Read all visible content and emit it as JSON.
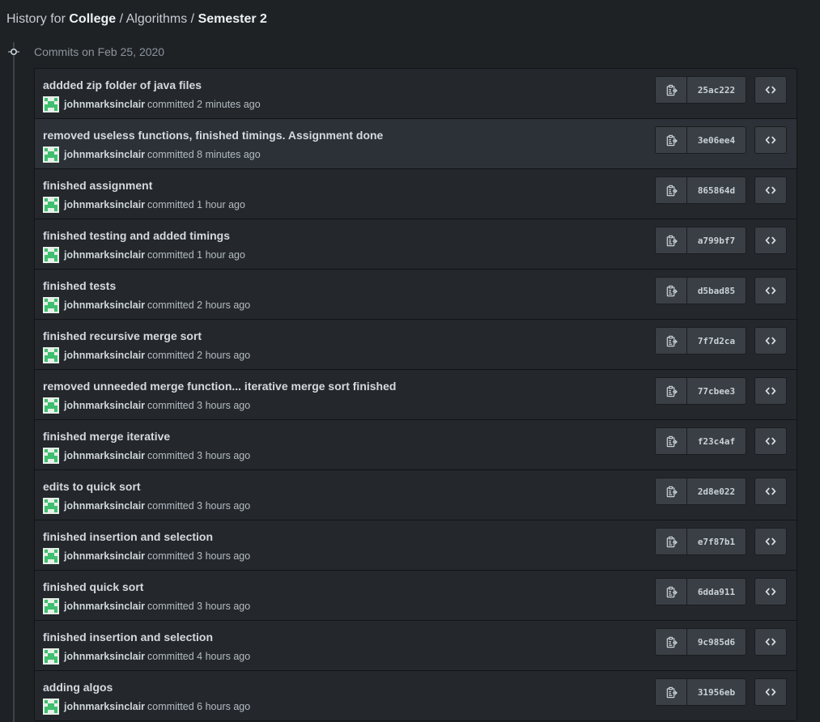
{
  "heading": {
    "prefix": "History for",
    "repo_owner": "College",
    "separator1": "/",
    "path_dir": "Algorithms",
    "separator2": "/",
    "path_current": "Semester 2"
  },
  "group": {
    "title": "Commits on Feb 25, 2020"
  },
  "colors": {
    "background": "#1f2225",
    "row": "#24282c",
    "row_highlight": "#2c3137",
    "button": "#3a3f45",
    "avatar_green": "#3fbf6f"
  },
  "icons": {
    "copy": "clipboard-icon",
    "browse": "code-icon",
    "timeline": "git-commit-icon"
  },
  "commits": [
    {
      "title": "addded zip folder of java files",
      "author": "johnmarksinclair",
      "time": "committed 2 minutes ago",
      "sha": "25ac222"
    },
    {
      "title": "removed useless functions, finished timings. Assignment done",
      "author": "johnmarksinclair",
      "time": "committed 8 minutes ago",
      "sha": "3e06ee4"
    },
    {
      "title": "finished assignment",
      "author": "johnmarksinclair",
      "time": "committed 1 hour ago",
      "sha": "865864d"
    },
    {
      "title": "finished testing and added timings",
      "author": "johnmarksinclair",
      "time": "committed 1 hour ago",
      "sha": "a799bf7"
    },
    {
      "title": "finished tests",
      "author": "johnmarksinclair",
      "time": "committed 2 hours ago",
      "sha": "d5bad85"
    },
    {
      "title": "finished recursive merge sort",
      "author": "johnmarksinclair",
      "time": "committed 2 hours ago",
      "sha": "7f7d2ca"
    },
    {
      "title": "removed unneeded merge function... iterative merge sort finished",
      "author": "johnmarksinclair",
      "time": "committed 3 hours ago",
      "sha": "77cbee3"
    },
    {
      "title": "finished merge iterative",
      "author": "johnmarksinclair",
      "time": "committed 3 hours ago",
      "sha": "f23c4af"
    },
    {
      "title": "edits to quick sort",
      "author": "johnmarksinclair",
      "time": "committed 3 hours ago",
      "sha": "2d8e022"
    },
    {
      "title": "finished insertion and selection",
      "author": "johnmarksinclair",
      "time": "committed 3 hours ago",
      "sha": "e7f87b1"
    },
    {
      "title": "finished quick sort",
      "author": "johnmarksinclair",
      "time": "committed 3 hours ago",
      "sha": "6dda911"
    },
    {
      "title": "finished insertion and selection",
      "author": "johnmarksinclair",
      "time": "committed 4 hours ago",
      "sha": "9c985d6"
    },
    {
      "title": "adding algos",
      "author": "johnmarksinclair",
      "time": "committed 6 hours ago",
      "sha": "31956eb"
    }
  ]
}
